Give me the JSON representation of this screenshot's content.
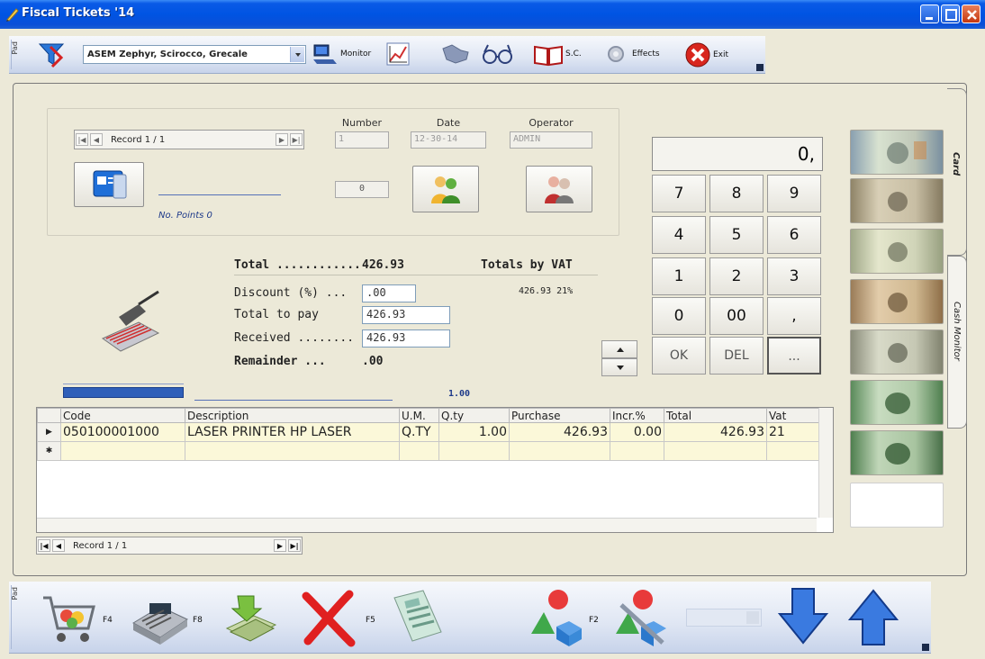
{
  "window": {
    "title": "Fiscal Tickets '14"
  },
  "top_toolbar": {
    "grip_label": "Pad",
    "company_select": "ASEM Zephyr, Scirocco, Grecale",
    "monitor_label": "Monitor",
    "sc_label": "S.C.",
    "effects_label": "Effects",
    "exit_label": "Exit"
  },
  "record_nav": {
    "label": "Record 1 / 1"
  },
  "header_fields": {
    "number_label": "Number",
    "number_value": "1",
    "date_label": "Date",
    "date_value": "12-30-14",
    "operator_label": "Operator",
    "operator_value": "ADMIN",
    "points_counter": "0",
    "no_points": "No. Points 0"
  },
  "totals": {
    "total_label": "Total ............",
    "total_value": "426.93",
    "totals_by_vat_label": "Totals by VAT",
    "vat_line": "426.93 21%",
    "discount_label": "Discount (%) ...",
    "discount_value": ".00",
    "total_to_pay_label": "Total to pay",
    "total_to_pay_value": "426.93",
    "received_label": "Received ........",
    "received_value": "426.93",
    "remainder_label": "Remainder ...",
    "remainder_value": ".00",
    "qty_total": "1.00"
  },
  "keypad": {
    "display": "0,",
    "keys": [
      "7",
      "8",
      "9",
      "4",
      "5",
      "6",
      "1",
      "2",
      "3",
      "0",
      "00",
      ","
    ],
    "ok": "OK",
    "del": "DEL",
    "more": "..."
  },
  "side_tabs": {
    "card": "Card",
    "cash_monitor": "Cash Monitor"
  },
  "grid": {
    "columns": [
      "Code",
      "Description",
      "U.M.",
      "Q.ty",
      "Purchase",
      "Incr.%",
      "Total",
      "Vat"
    ],
    "rows": [
      {
        "code": "050100001000",
        "description": "LASER PRINTER HP LASER",
        "um": "Q.TY",
        "qty": "1.00",
        "purchase": "426.93",
        "incr": "0.00",
        "total": "426.93",
        "vat": "21"
      }
    ]
  },
  "grid_nav": {
    "label": "Record 1 / 1"
  },
  "bottom_toolbar": {
    "grip_label": "Pad",
    "f4": "F4",
    "f8": "F8",
    "f5": "F5",
    "f2": "F2"
  },
  "colors": {
    "titlebar": "#0054e3",
    "accent_blue": "#2f5fb9",
    "row_highlight": "#fbf8d9",
    "panel_bg": "#ece9d8"
  }
}
